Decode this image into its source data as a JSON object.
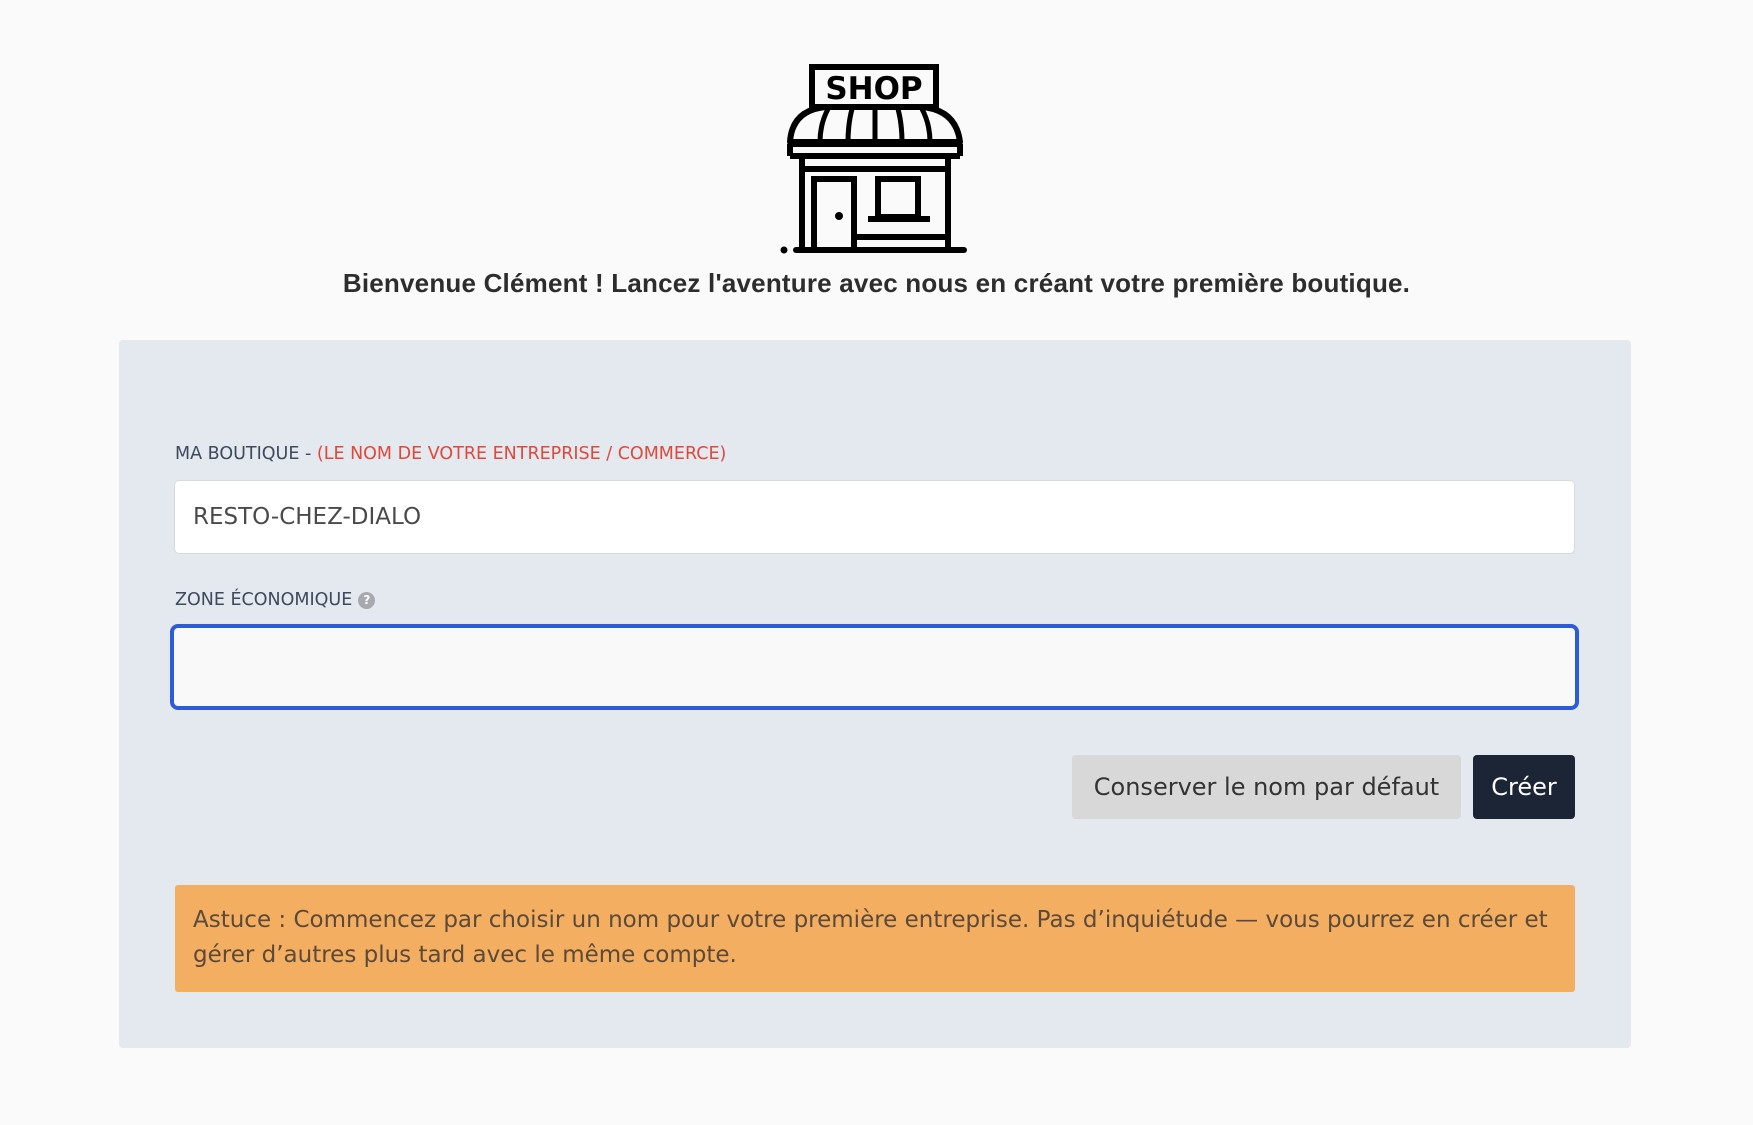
{
  "header": {
    "logo_icon": "shop-storefront-icon",
    "logo_text": "SHOP",
    "welcome": "Bienvenue Clément ! Lancez l'aventure avec nous en créant votre première boutique."
  },
  "form": {
    "name_label": "MA BOUTIQUE -",
    "name_hint": "(LE NOM DE VOTRE ENTREPRISE / COMMERCE)",
    "name_value": "RESTO-CHEZ-DIALO",
    "zone_label": "ZONE ÉCONOMIQUE",
    "zone_help_icon": "question-circle-icon",
    "zone_help_glyph": "?",
    "zone_value": ""
  },
  "actions": {
    "keep_default_label": "Conserver le nom par défaut",
    "create_label": "Créer"
  },
  "tip": {
    "text": "Astuce : Commencez par choisir un nom pour votre première entreprise. Pas d’inquiétude — vous pourrez en créer et gérer d’autres plus tard avec le même compte."
  },
  "colors": {
    "page_bg": "#fafafa",
    "card_bg": "#e4e8ef",
    "hint_red": "#e0483a",
    "focus_blue": "#2e5bd8",
    "primary_dark": "#1c2536",
    "tip_orange": "#f3ae61"
  }
}
